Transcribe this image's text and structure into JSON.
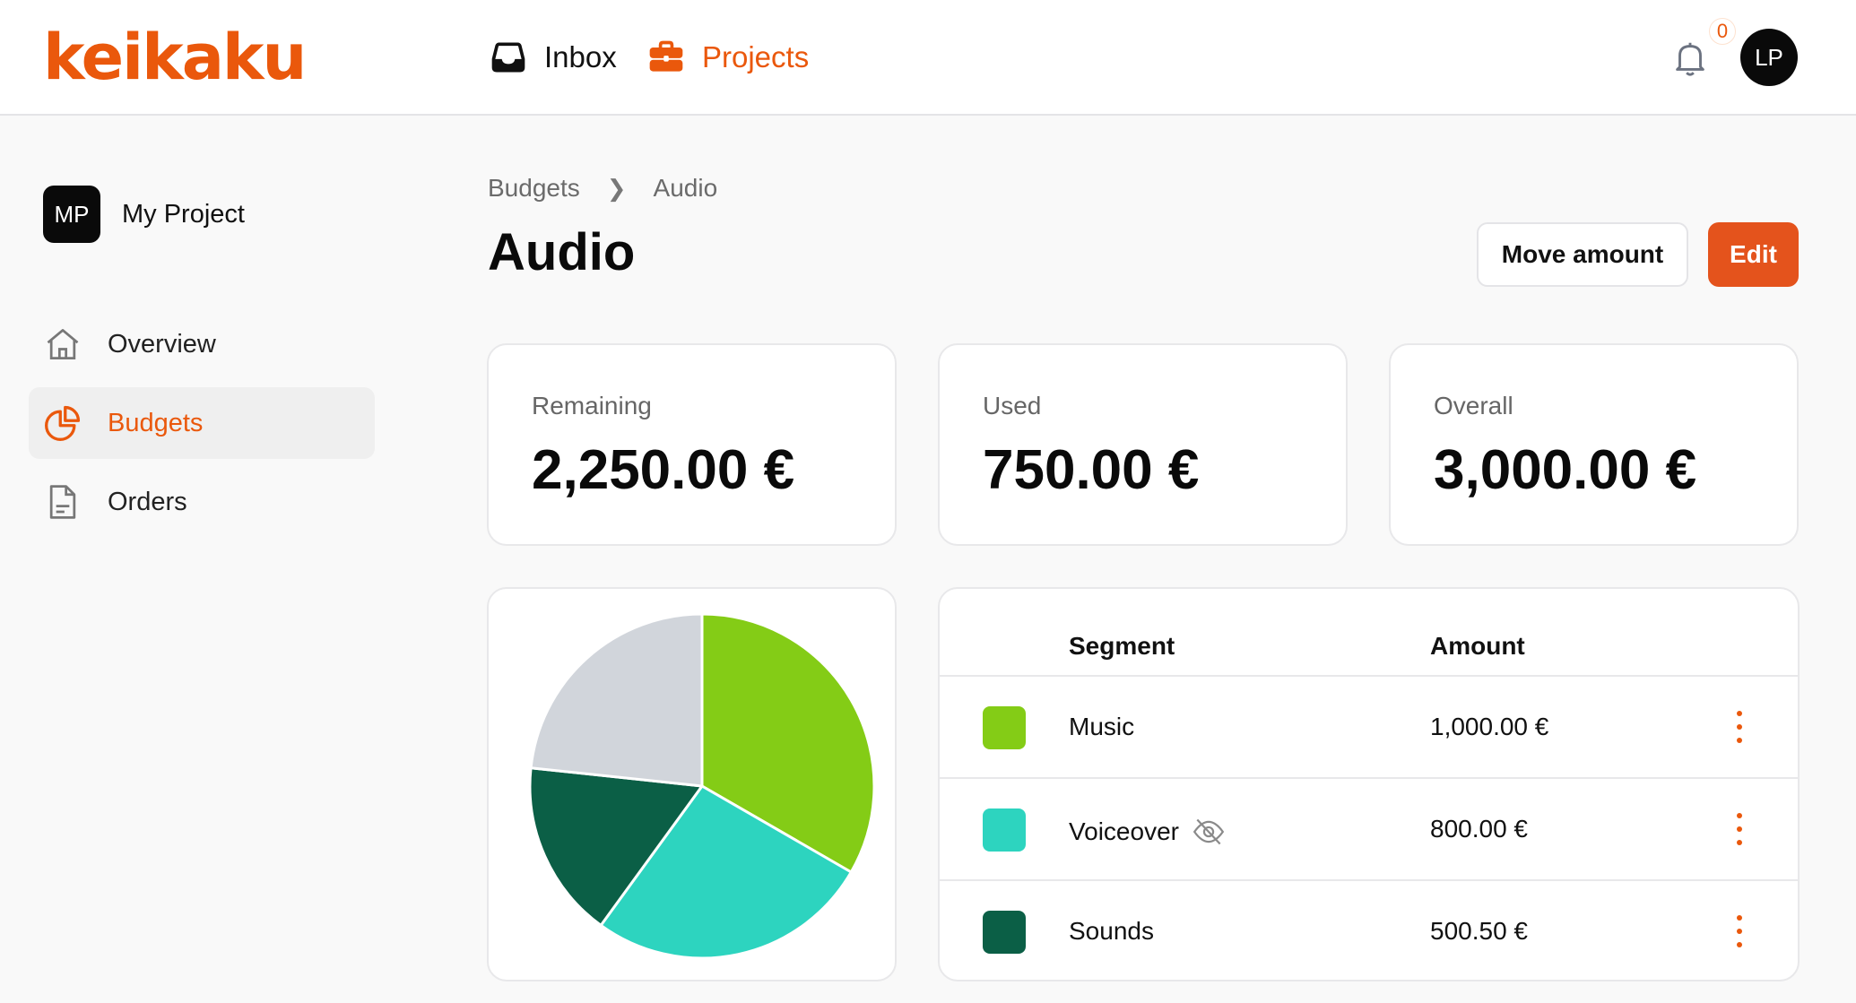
{
  "app": {
    "logo": "keikaku",
    "nav": [
      {
        "label": "Inbox",
        "icon": "inbox-icon"
      },
      {
        "label": "Projects",
        "icon": "briefcase-icon",
        "active": true
      }
    ],
    "notifications_count": "0",
    "user_initials": "LP"
  },
  "sidebar": {
    "project_initials": "MP",
    "project_name": "My Project",
    "items": [
      {
        "label": "Overview",
        "icon": "home-icon"
      },
      {
        "label": "Budgets",
        "icon": "pie-chart-icon",
        "active": true
      },
      {
        "label": "Orders",
        "icon": "document-icon"
      }
    ]
  },
  "breadcrumb": [
    "Budgets",
    "Audio"
  ],
  "page": {
    "title": "Audio",
    "move_label": "Move amount",
    "edit_label": "Edit"
  },
  "stats": [
    {
      "label": "Remaining",
      "value": "2,250.00 €"
    },
    {
      "label": "Used",
      "value": "750.00 €"
    },
    {
      "label": "Overall",
      "value": "3,000.00 €"
    }
  ],
  "table": {
    "headers": {
      "segment": "Segment",
      "amount": "Amount"
    },
    "rows": [
      {
        "segment": "Music",
        "amount": "1,000.00 €",
        "color": "#84cc16",
        "hidden": false
      },
      {
        "segment": "Voiceover",
        "amount": "800.00 €",
        "color": "#2dd4bf",
        "hidden": true
      },
      {
        "segment": "Sounds",
        "amount": "500.50 €",
        "color": "#0b5f46",
        "hidden": false
      }
    ]
  },
  "chart_data": {
    "type": "pie",
    "categories": [
      "Music",
      "Voiceover",
      "Sounds",
      "Remaining"
    ],
    "values": [
      1000.0,
      800.0,
      500.5,
      699.5
    ],
    "colors": [
      "#84cc16",
      "#2dd4bf",
      "#0b5f46",
      "#d1d5db"
    ]
  },
  "colors": {
    "accent": "#ea580c"
  }
}
